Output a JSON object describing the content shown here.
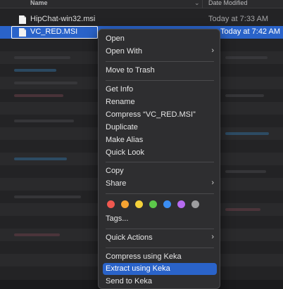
{
  "finder": {
    "columns": {
      "name": "Name",
      "date_modified": "Date Modified"
    },
    "files": [
      {
        "name": "HipChat-win32.msi",
        "date": "Today at 7:33 AM",
        "selected": false
      },
      {
        "name": "VC_RED.MSI",
        "date": "Today at 7:42 AM",
        "selected": true
      }
    ]
  },
  "context_menu": {
    "items": [
      {
        "label": "Open",
        "submenu": false
      },
      {
        "label": "Open With",
        "submenu": true
      },
      {
        "label": "Move to Trash",
        "submenu": false
      },
      {
        "label": "Get Info",
        "submenu": false
      },
      {
        "label": "Rename",
        "submenu": false
      },
      {
        "label": "Compress “VC_RED.MSI”",
        "submenu": false
      },
      {
        "label": "Duplicate",
        "submenu": false
      },
      {
        "label": "Make Alias",
        "submenu": false
      },
      {
        "label": "Quick Look",
        "submenu": false
      },
      {
        "label": "Copy",
        "submenu": false
      },
      {
        "label": "Share",
        "submenu": true
      },
      {
        "label": "Tags...",
        "submenu": false
      },
      {
        "label": "Quick Actions",
        "submenu": true
      },
      {
        "label": "Compress using Keka",
        "submenu": false
      },
      {
        "label": "Extract using Keka",
        "submenu": false,
        "highlighted": true
      },
      {
        "label": "Send to Keka",
        "submenu": false
      }
    ],
    "tag_colors": [
      "#f0584f",
      "#f6a332",
      "#f4d13a",
      "#5cc84a",
      "#3b8df2",
      "#b66bf0",
      "#9d9d9f"
    ],
    "tag_color_names": [
      "red",
      "orange",
      "yellow",
      "green",
      "blue",
      "purple",
      "gray"
    ],
    "submenu_icon": "chevron-right-icon",
    "highlight_color": "#2a63c9"
  }
}
